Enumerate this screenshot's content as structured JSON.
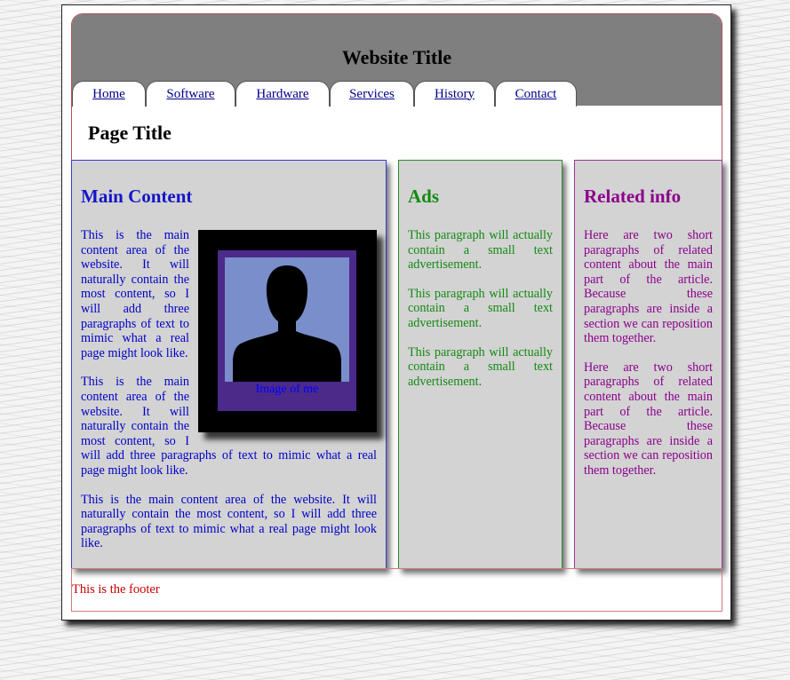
{
  "header": {
    "site_title": "Website Title",
    "tabs": [
      {
        "label": "Home"
      },
      {
        "label": "Software"
      },
      {
        "label": "Hardware"
      },
      {
        "label": "Services"
      },
      {
        "label": "History"
      },
      {
        "label": "Contact"
      }
    ]
  },
  "page_title": "Page Title",
  "main": {
    "heading": "Main Content",
    "paragraphs": [
      "This is the main content area of the website. It will naturally contain the most content, so I will add three paragraphs of text to mimic what a real page might look like.",
      "This is the main content area of the website. It will naturally contain the most content, so I will add three paragraphs of text to mimic what a real page might look like.",
      "This is the main content area of the website. It will naturally contain the most content, so I will add three paragraphs of text to mimic what a real page might look like."
    ],
    "image_caption": "Image of me"
  },
  "ads": {
    "heading": "Ads",
    "paragraphs": [
      "This paragraph will actually contain a small text advertisement.",
      "This paragraph will actually contain a small text advertisement.",
      "This paragraph will actually contain a small text advertisement."
    ]
  },
  "related": {
    "heading": "Related info",
    "paragraphs": [
      "Here are two short paragraphs of related content about the main part of the article. Because these paragraphs are inside a section we can reposition them together.",
      "Here are two short paragraphs of related content about the main part of the article. Because these paragraphs are inside a section we can reposition them together."
    ]
  },
  "footer": {
    "text": "This is the footer"
  },
  "colors": {
    "banner": "#7f7f7f",
    "main_text": "#0000c8",
    "ads_text": "#138a13",
    "related_text": "#8b008b",
    "footer_text": "#c80000"
  },
  "icons": {
    "profile_image": "person-silhouette-icon"
  }
}
